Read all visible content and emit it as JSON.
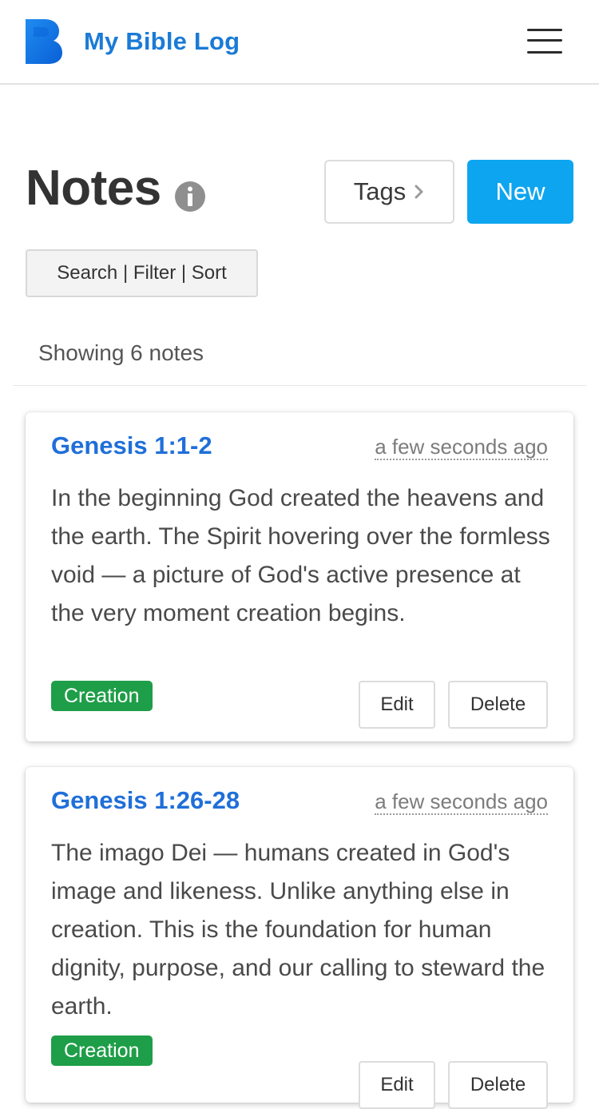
{
  "header": {
    "brand": "My Bible Log",
    "logo_icon": "bible-log-b-logo",
    "menu_icon": "hamburger-menu-icon",
    "brand_color": "#1a7bd6"
  },
  "page": {
    "title": "Notes",
    "info_icon": "info-icon",
    "tags_label": "Tags",
    "new_label": "New",
    "search_label": "Search | Filter | Sort",
    "showing_text": "Showing 6 notes",
    "accent_color": "#0ea5f0"
  },
  "notes": [
    {
      "reference": "Genesis 1:1-2",
      "time": "a few seconds ago",
      "body": "In the beginning God created the heavens and the earth. The Spirit hovering over the formless void — a picture of God's active presence at the very moment creation begins.",
      "tag": "Creation",
      "edit_label": "Edit",
      "delete_label": "Delete"
    },
    {
      "reference": "Genesis 1:26-28",
      "time": "a few seconds ago",
      "body": "The imago Dei — humans created in God's image and likeness. Unlike anything else in creation. This is the foundation for human dignity, purpose, and our calling to steward the earth.",
      "tag": "Creation",
      "edit_label": "Edit",
      "delete_label": "Delete"
    }
  ],
  "colors": {
    "tag_green": "#1e9e48",
    "link_blue": "#1f6fd9"
  }
}
